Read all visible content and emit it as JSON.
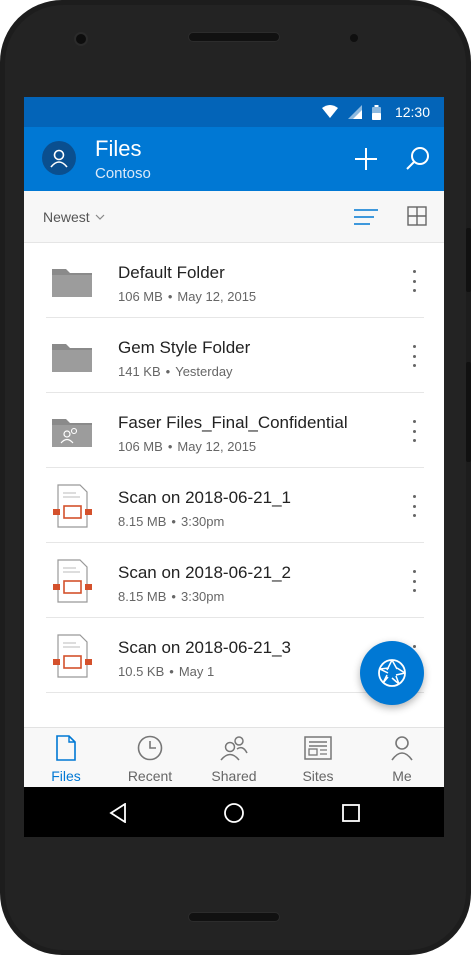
{
  "status_bar": {
    "time": "12:30",
    "icons": [
      "wifi-icon",
      "signal-icon",
      "battery-icon"
    ]
  },
  "app_bar": {
    "title": "Files",
    "subtitle": "Contoso",
    "actions": [
      "add-icon",
      "search-icon"
    ]
  },
  "toolbar": {
    "sort_label": "Newest",
    "views": [
      "list-view-icon",
      "grid-view-icon"
    ]
  },
  "files": [
    {
      "name": "Default Folder",
      "size": "106 MB",
      "date": "May 12, 2015",
      "type": "folder"
    },
    {
      "name": "Gem Style Folder",
      "size": "141 KB",
      "date": "Yesterday",
      "type": "folder"
    },
    {
      "name": "Faser Files_Final_Confidential",
      "size": "106 MB",
      "date": "May 12, 2015",
      "type": "shared-folder"
    },
    {
      "name": "Scan on 2018-06-21_1",
      "size": "8.15 MB",
      "date": "3:30pm",
      "type": "scan"
    },
    {
      "name": "Scan on 2018-06-21_2",
      "size": "8.15 MB",
      "date": "3:30pm",
      "type": "scan"
    },
    {
      "name": "Scan on 2018-06-21_3",
      "size": "10.5 KB",
      "date": "May 1",
      "type": "scan"
    }
  ],
  "fab": {
    "icon": "camera-shutter-icon"
  },
  "bottom_nav": [
    {
      "label": "Files",
      "icon": "file-icon",
      "active": true
    },
    {
      "label": "Recent",
      "icon": "clock-icon",
      "active": false
    },
    {
      "label": "Shared",
      "icon": "people-icon",
      "active": false
    },
    {
      "label": "Sites",
      "icon": "sites-icon",
      "active": false
    },
    {
      "label": "Me",
      "icon": "person-icon",
      "active": false
    }
  ],
  "colors": {
    "accent": "#0078d4",
    "status_bar": "#0364b8",
    "scan_accent": "#d4512c"
  }
}
